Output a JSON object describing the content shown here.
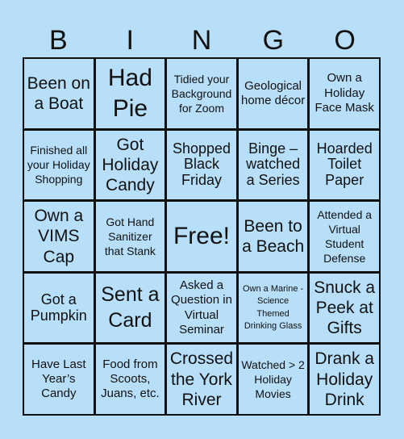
{
  "card": {
    "header": [
      "B",
      "I",
      "N",
      "G",
      "O"
    ],
    "background_color": "#b7dff9",
    "border_color": "#111111",
    "cells": [
      {
        "text": "Been on a Boat",
        "size": "l"
      },
      {
        "text": "Had Pie",
        "size": "xl"
      },
      {
        "text": "Tidied your Background for Zoom",
        "size": "xs"
      },
      {
        "text": "Geological home décor",
        "size": "s"
      },
      {
        "text": "Own a Holiday Face Mask",
        "size": "s"
      },
      {
        "text": "Finished all your Holiday Shopping",
        "size": "xs"
      },
      {
        "text": "Got Holiday Candy",
        "size": "l"
      },
      {
        "text": "Shopped Black Friday",
        "size": "m"
      },
      {
        "text": "Binge – watched a Series",
        "size": "m"
      },
      {
        "text": "Hoarded Toilet Paper",
        "size": "m"
      },
      {
        "text": "Own a VIMS Cap",
        "size": "l"
      },
      {
        "text": "Got Hand Sanitizer that Stank",
        "size": "xs"
      },
      {
        "text": "Free!",
        "size": "xl"
      },
      {
        "text": "Been to a Beach",
        "size": "l"
      },
      {
        "text": "Attended a Virtual Student Defense",
        "size": "xs"
      },
      {
        "text": "Got a Pumpkin",
        "size": "m"
      },
      {
        "text": "Sent a Card",
        "size": "xl-sm"
      },
      {
        "text": "Asked a Question in Virtual Seminar",
        "size": "s"
      },
      {
        "text": "Own a Marine - Science Themed Drinking Glass",
        "size": "xxs"
      },
      {
        "text": "Snuck a Peek at Gifts",
        "size": "l"
      },
      {
        "text": "Have Last Year’s Candy",
        "size": "s"
      },
      {
        "text": "Food from Scoots, Juans, etc.",
        "size": "s"
      },
      {
        "text": "Crossed the York River",
        "size": "l"
      },
      {
        "text": "Watched > 2 Holiday Movies",
        "size": "xs"
      },
      {
        "text": "Drank a Holiday Drink",
        "size": "l"
      }
    ]
  }
}
